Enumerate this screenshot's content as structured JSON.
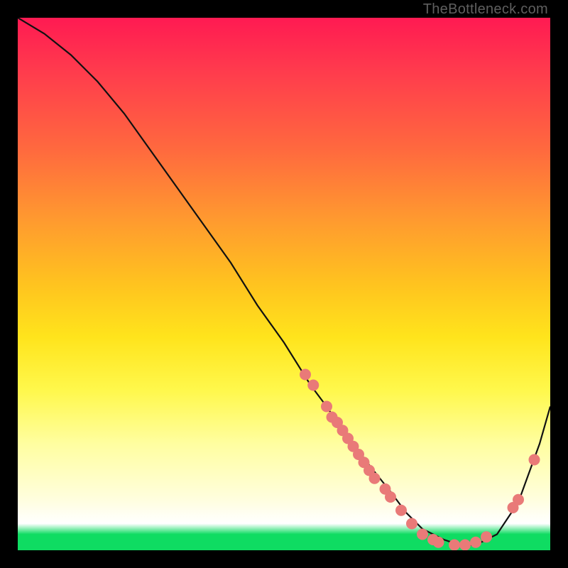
{
  "watermark": "TheBottleneck.com",
  "chart_data": {
    "type": "line",
    "title": "",
    "xlabel": "",
    "ylabel": "",
    "xlim": [
      0,
      100
    ],
    "ylim": [
      0,
      100
    ],
    "grid": false,
    "legend": false,
    "annotations": [],
    "series": [
      {
        "name": "curve",
        "x": [
          0,
          5,
          10,
          15,
          20,
          25,
          30,
          35,
          40,
          45,
          50,
          55,
          58,
          60,
          63,
          66,
          70,
          73,
          76,
          80,
          83,
          86,
          90,
          94,
          98,
          100
        ],
        "values": [
          100,
          97,
          93,
          88,
          82,
          75,
          68,
          61,
          54,
          46,
          39,
          31,
          27,
          24,
          20,
          16,
          11,
          7,
          4,
          2,
          1,
          1,
          3,
          9,
          20,
          27
        ]
      }
    ],
    "scatter_points": {
      "name": "dots",
      "points": [
        {
          "x": 54,
          "y": 33
        },
        {
          "x": 55.5,
          "y": 31
        },
        {
          "x": 58,
          "y": 27
        },
        {
          "x": 59,
          "y": 25
        },
        {
          "x": 60,
          "y": 24
        },
        {
          "x": 61,
          "y": 22.5
        },
        {
          "x": 62,
          "y": 21
        },
        {
          "x": 63,
          "y": 19.5
        },
        {
          "x": 64,
          "y": 18
        },
        {
          "x": 65,
          "y": 16.5
        },
        {
          "x": 66,
          "y": 15
        },
        {
          "x": 67,
          "y": 13.5
        },
        {
          "x": 69,
          "y": 11.5
        },
        {
          "x": 70,
          "y": 10
        },
        {
          "x": 72,
          "y": 7.5
        },
        {
          "x": 74,
          "y": 5
        },
        {
          "x": 76,
          "y": 3
        },
        {
          "x": 78,
          "y": 2
        },
        {
          "x": 79,
          "y": 1.5
        },
        {
          "x": 82,
          "y": 1
        },
        {
          "x": 84,
          "y": 1
        },
        {
          "x": 86,
          "y": 1.5
        },
        {
          "x": 88,
          "y": 2.5
        },
        {
          "x": 93,
          "y": 8
        },
        {
          "x": 94,
          "y": 9.5
        },
        {
          "x": 97,
          "y": 17
        }
      ]
    },
    "colors": {
      "curve": "#111111",
      "dots": "#e97a78",
      "gradient_top": "#ff1a52",
      "gradient_mid": "#ffe41c",
      "gradient_bottom": "#0fdc62",
      "frame": "#000000"
    }
  }
}
